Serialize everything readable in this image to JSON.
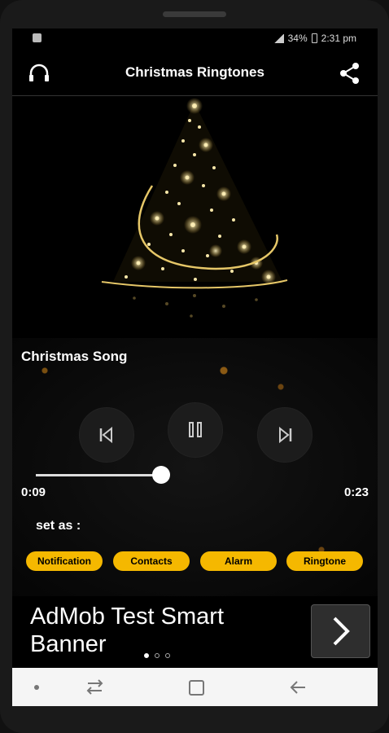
{
  "status_bar": {
    "battery": "34%",
    "time": "2:31 pm"
  },
  "app_bar": {
    "title": "Christmas Ringtones",
    "left_icon": "headphones-icon",
    "right_icon": "share-icon"
  },
  "player": {
    "song_title": "Christmas Song",
    "current_time": "0:09",
    "total_time": "0:23",
    "progress": 0.39,
    "set_as_label": "set as :",
    "set_as_options": [
      "Notification",
      "Contacts",
      "Alarm",
      "Ringtone"
    ]
  },
  "ad": {
    "text": "AdMob Test Smart Banner",
    "arrow_icon": "chevron-right-icon",
    "page_count": 3,
    "active_page": 0
  },
  "colors": {
    "accent": "#F5B800",
    "background": "#000000",
    "text": "#FFFFFF"
  }
}
